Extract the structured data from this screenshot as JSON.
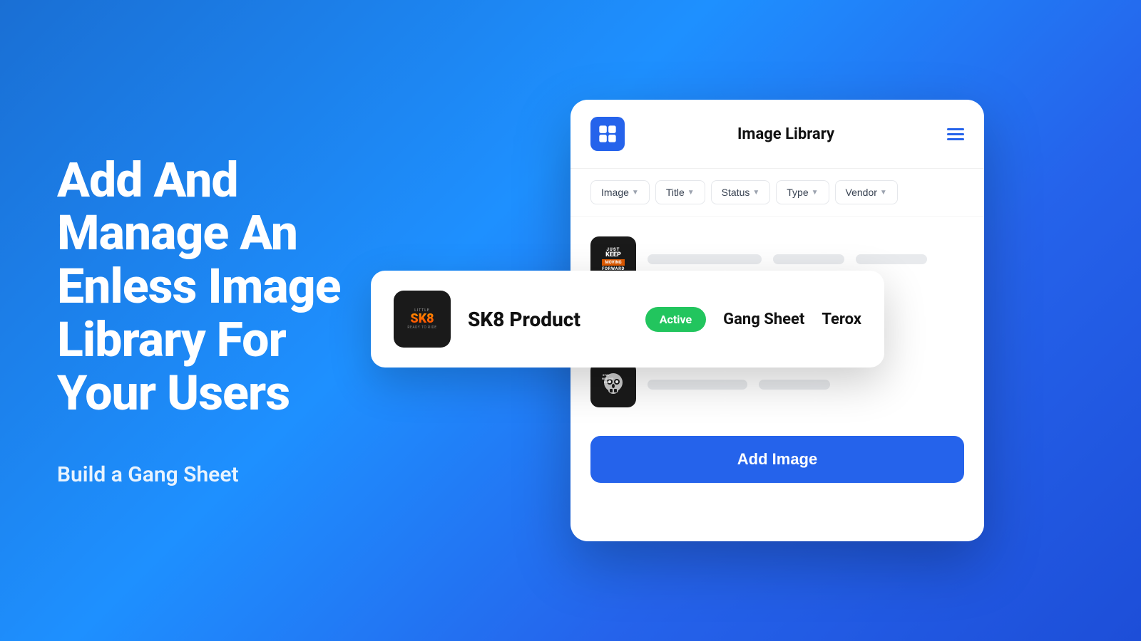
{
  "background": {
    "gradient_start": "#1a6fd4",
    "gradient_end": "#1d4ed8"
  },
  "left": {
    "hero_title": "Add And Manage An Enless Image Library For Your Users",
    "subtitle": "Build a Gang Sheet"
  },
  "app": {
    "title": "Image Library",
    "logo_alt": "App Logo",
    "hamburger_alt": "Menu",
    "filters": [
      {
        "label": "Image"
      },
      {
        "label": "Title"
      },
      {
        "label": "Status"
      },
      {
        "label": "Type"
      },
      {
        "label": "Vendor"
      }
    ],
    "rows": [
      {
        "id": "row-1",
        "image_alt": "Just Keep Forward sticker image",
        "image_text_lines": [
          "JUST",
          "KEEP",
          "MOVING",
          "FORWARD"
        ],
        "has_data": false
      },
      {
        "id": "row-2-active",
        "image_alt": "SK8 Product sticker image",
        "title": "SK8 Product",
        "status": "Active",
        "status_color": "#22c55e",
        "type": "Gang Sheet",
        "vendor": "Terox",
        "is_featured": true
      },
      {
        "id": "row-3",
        "image_alt": "Stay Wild And Free skull image",
        "has_data": false
      }
    ],
    "add_button_label": "Add Image"
  }
}
